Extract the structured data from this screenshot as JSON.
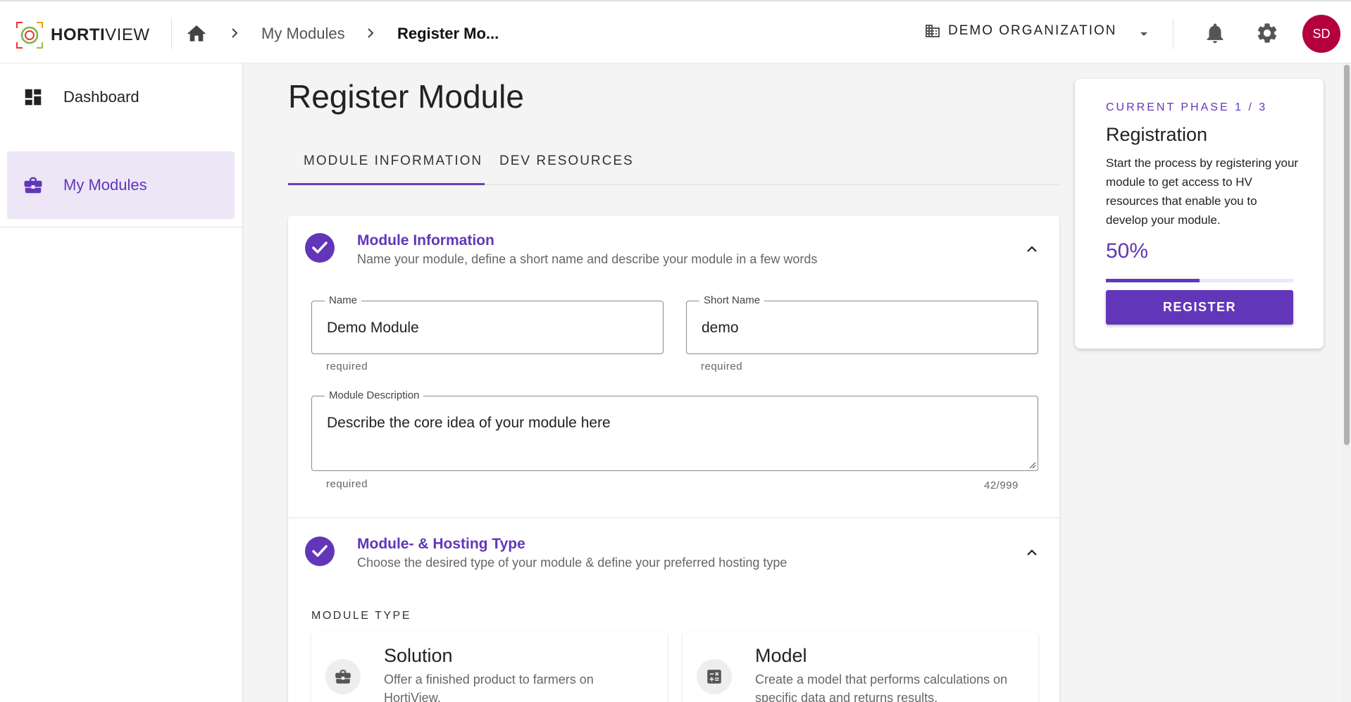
{
  "header": {
    "logo_bold": "HORTI",
    "logo_light": "VIEW",
    "breadcrumb": [
      "My Modules",
      "Register Mo..."
    ],
    "organization": "DEMO ORGANIZATION",
    "avatar_initials": "SD"
  },
  "sidebar": {
    "items": [
      {
        "label": "Dashboard",
        "icon": "dashboard-icon"
      },
      {
        "label": "My Modules",
        "icon": "briefcase-icon",
        "active": true
      }
    ]
  },
  "main": {
    "title": "Register Module",
    "tabs": [
      {
        "label": "MODULE INFORMATION",
        "active": true
      },
      {
        "label": "DEV RESOURCES"
      }
    ],
    "module_info": {
      "title": "Module Information",
      "subtitle": "Name your module, define a short name and describe your module in a few words",
      "name_label": "Name",
      "name_value": "Demo Module",
      "name_hint": "required",
      "short_name_label": "Short Name",
      "short_name_value": "demo",
      "short_name_hint": "required",
      "description_label": "Module Description",
      "description_value": "Describe the core idea of your module here",
      "description_hint": "required",
      "description_counter": "42/999"
    },
    "hosting": {
      "title": "Module- & Hosting Type",
      "subtitle": "Choose the desired type of your module & define your preferred hosting type",
      "module_type_label": "MODULE TYPE",
      "types": [
        {
          "title": "Solution",
          "description": "Offer a finished product to farmers on HortiView."
        },
        {
          "title": "Model",
          "description": "Create a model that performs calculations on specific data and returns results."
        }
      ]
    }
  },
  "phase_card": {
    "kicker": "CURRENT PHASE 1 / 3",
    "title": "Registration",
    "description": "Start the process by registering your module to get access to HV resources that enable you to develop your module.",
    "progress_label": "50%",
    "progress": 0.5,
    "button_label": "REGISTER"
  },
  "colors": {
    "accent": "#6236b9",
    "avatar": "#b5003f"
  }
}
